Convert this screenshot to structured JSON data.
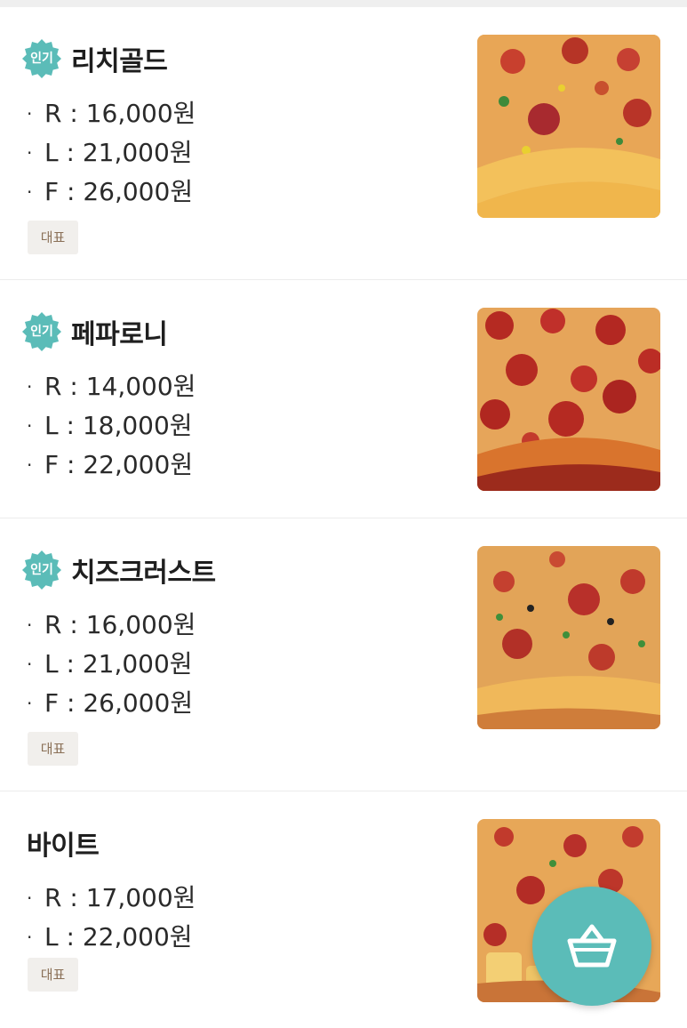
{
  "colors": {
    "accent": "#5bbcb8",
    "tag_bg": "#f1efec",
    "tag_text": "#8a7057"
  },
  "menu": [
    {
      "badge": "인기",
      "name": "리치골드",
      "prices": [
        "R : 16,000원",
        "L : 21,000원",
        "F : 26,000원"
      ],
      "tag": "대표",
      "image_icon": "pizza-photo"
    },
    {
      "badge": "인기",
      "name": "페파로니",
      "prices": [
        "R : 14,000원",
        "L : 18,000원",
        "F : 22,000원"
      ],
      "tag": "",
      "image_icon": "pizza-photo"
    },
    {
      "badge": "인기",
      "name": "치즈크러스트",
      "prices": [
        "R : 16,000원",
        "L : 21,000원",
        "F : 26,000원"
      ],
      "tag": "대표",
      "image_icon": "pizza-photo"
    },
    {
      "badge": "",
      "name": "바이트",
      "prices": [
        "R : 17,000원",
        "L : 22,000원"
      ],
      "tag": "대표",
      "image_icon": "pizza-photo"
    }
  ],
  "cart_button": {
    "icon": "basket-icon"
  }
}
